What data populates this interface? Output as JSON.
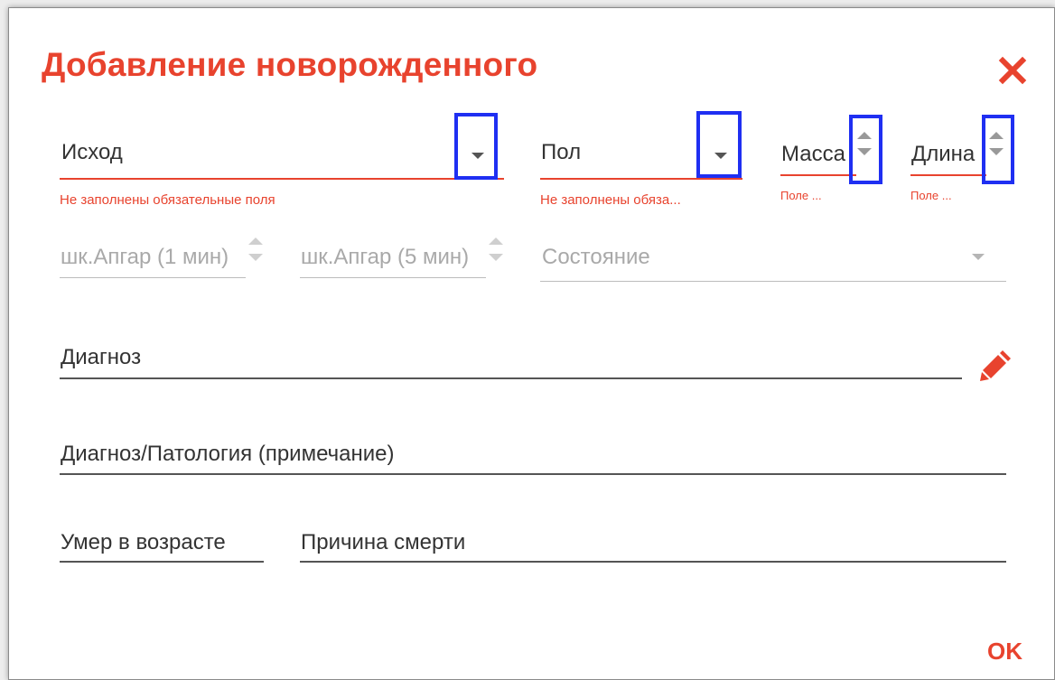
{
  "dialog": {
    "title": "Добавление новорожденного",
    "close_icon": "close-icon",
    "ok_label": "OK"
  },
  "fields": {
    "outcome": {
      "label": "Исход",
      "error": "Не заполнены обязательные поля"
    },
    "sex": {
      "label": "Пол",
      "error": "Не заполнены обяза..."
    },
    "mass": {
      "label": "Масса",
      "error": "Поле ..."
    },
    "length": {
      "label": "Длина",
      "error": "Поле ..."
    },
    "apgar1": {
      "label": "шк.Апгар (1 мин)"
    },
    "apgar5": {
      "label": "шк.Апгар (5 мин)"
    },
    "state": {
      "label": "Состояние"
    },
    "diagnosis": {
      "label": "Диагноз"
    },
    "pathology_note": {
      "label": "Диагноз/Патология (примечание)"
    },
    "died_age": {
      "label": "Умер в возрасте"
    },
    "death_cause": {
      "label": "Причина смерти"
    }
  },
  "colors": {
    "accent": "#e8432e",
    "highlight": "#1f2ff2"
  }
}
